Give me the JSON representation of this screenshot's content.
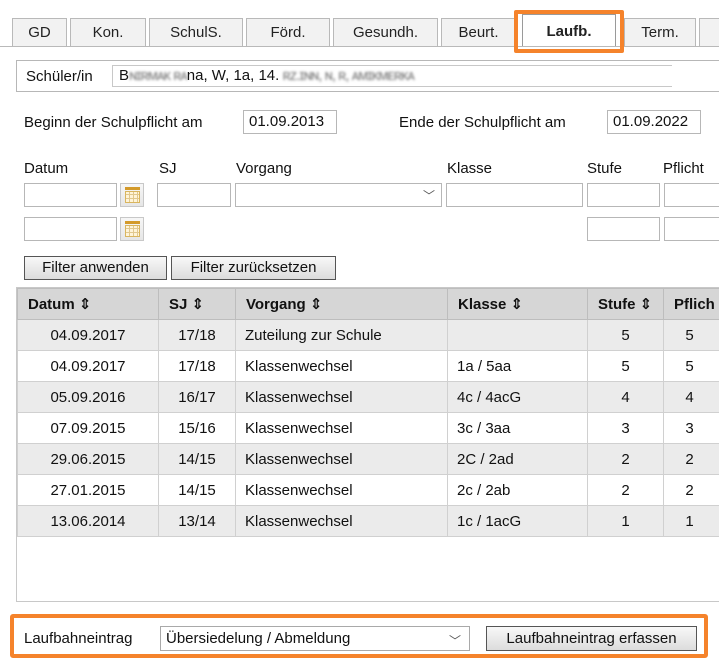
{
  "tabs": [
    {
      "label": "GD"
    },
    {
      "label": "Kon."
    },
    {
      "label": "SchulS."
    },
    {
      "label": "Förd."
    },
    {
      "label": "Gesundh."
    },
    {
      "label": "Beurt."
    },
    {
      "label": "Laufb.",
      "active": true
    },
    {
      "label": "Term."
    }
  ],
  "student": {
    "label": "Schüler/in",
    "value_obscured_prefix": "B",
    "value_visible": "na, W, 1a, 14."
  },
  "period": {
    "start_label": "Beginn der Schulpflicht am",
    "start_value": "01.09.2013",
    "end_label": "Ende der Schulpflicht am",
    "end_value": "01.09.2022"
  },
  "filter": {
    "labels": {
      "datum": "Datum",
      "sj": "SJ",
      "vorgang": "Vorgang",
      "klasse": "Klasse",
      "stufe": "Stufe",
      "pflicht": "Pflicht"
    },
    "apply_label": "Filter anwenden",
    "reset_label": "Filter zurücksetzen"
  },
  "table": {
    "headers": [
      "Datum ⇕",
      "SJ ⇕",
      "Vorgang ⇕",
      "Klasse ⇕",
      "Stufe ⇕",
      "Pflich"
    ],
    "rows": [
      [
        "04.09.2017",
        "17/18",
        "Zuteilung zur Schule",
        "",
        "5",
        "5"
      ],
      [
        "04.09.2017",
        "17/18",
        "Klassenwechsel",
        "1a / 5aa",
        "5",
        "5"
      ],
      [
        "05.09.2016",
        "16/17",
        "Klassenwechsel",
        "4c / 4acG",
        "4",
        "4"
      ],
      [
        "07.09.2015",
        "15/16",
        "Klassenwechsel",
        "3c / 3aa",
        "3",
        "3"
      ],
      [
        "29.06.2015",
        "14/15",
        "Klassenwechsel",
        "2C / 2ad",
        "2",
        "2"
      ],
      [
        "27.01.2015",
        "14/15",
        "Klassenwechsel",
        "2c / 2ab",
        "2",
        "2"
      ],
      [
        "13.06.2014",
        "13/14",
        "Klassenwechsel",
        "1c / 1acG",
        "1",
        "1"
      ]
    ]
  },
  "entry": {
    "label": "Laufbahneintrag",
    "selected": "Übersiedelung / Abmeldung",
    "button_label": "Laufbahneintrag erfassen"
  },
  "colors": {
    "highlight": "#f5832b",
    "header_bg": "#d6d6d6",
    "row_alt": "#ebebeb"
  }
}
